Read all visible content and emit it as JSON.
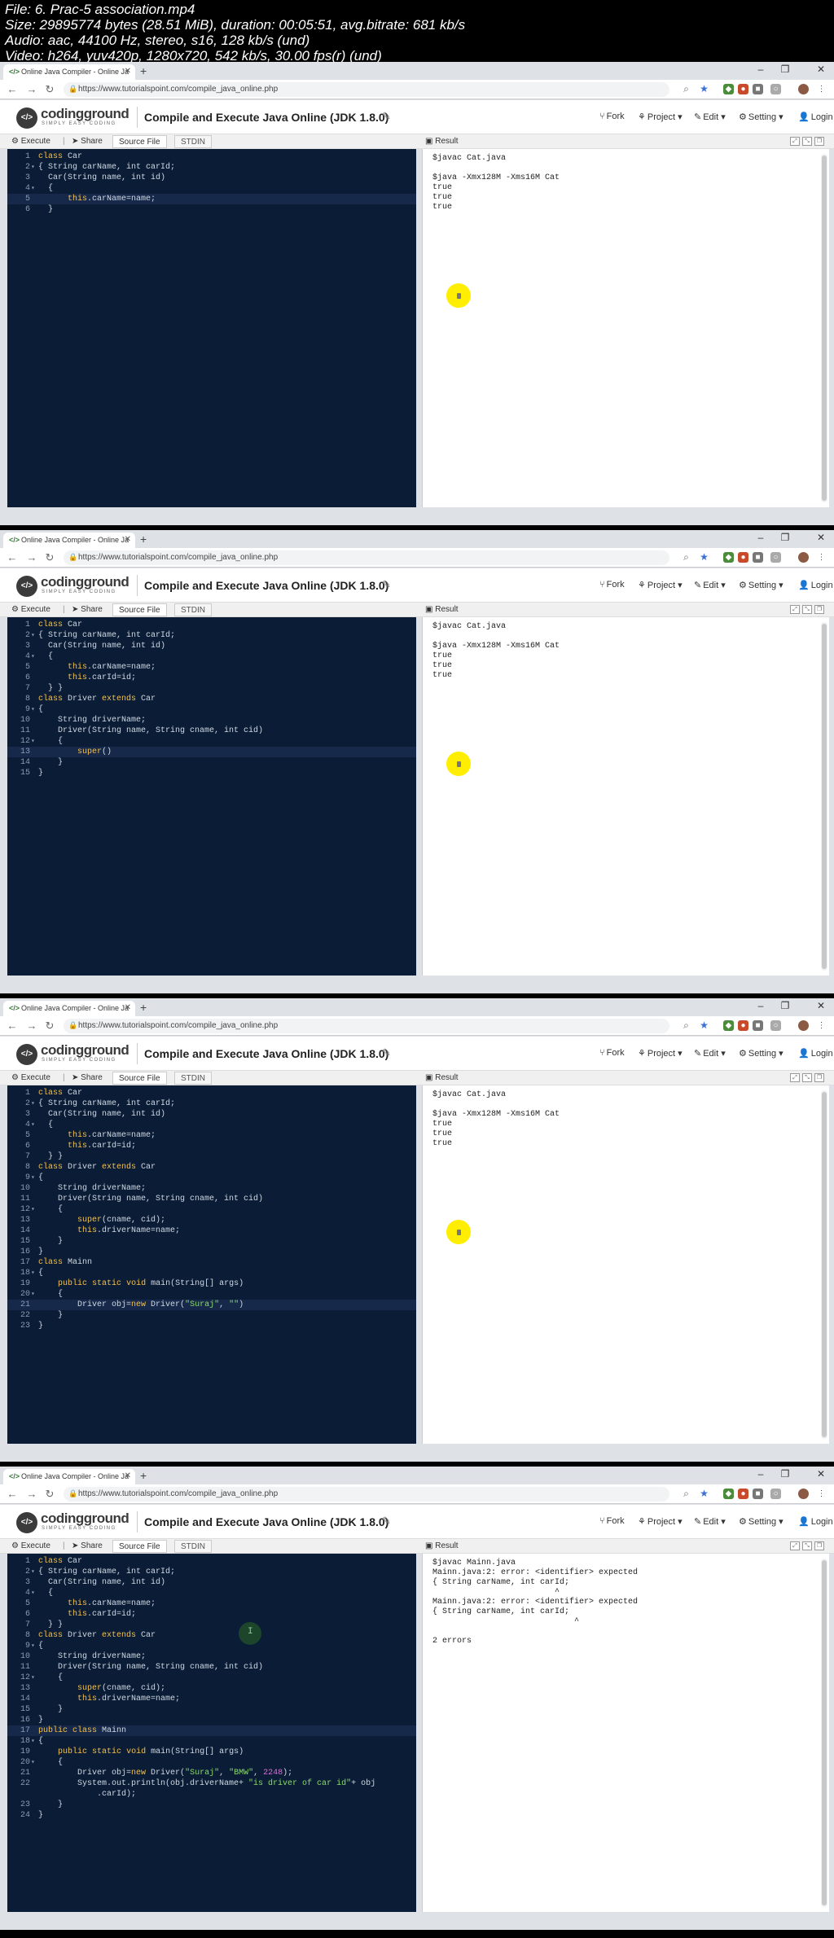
{
  "file_info": {
    "line1": "File: 6. Prac-5 association.mp4",
    "line2": "Size: 29895774 bytes (28.51 MiB), duration: 00:05:51, avg.bitrate: 681 kb/s",
    "line3": "Audio: aac, 44100 Hz, stereo, s16, 128 kb/s (und)",
    "line4": "Video: h264, yuv420p, 1280x720, 542 kb/s, 30.00 fps(r) (und)"
  },
  "browser": {
    "tab_title": "Online Java Compiler - Online Ja",
    "url": "https://www.tutorialspoint.com/compile_java_online.php"
  },
  "site": {
    "logo_text": "codingground",
    "logo_sub": "SIMPLY EASY CODING",
    "page_title": "Compile and Execute Java Online (JDK 1.8.0)",
    "menu": {
      "fork": "Fork",
      "project": "Project",
      "edit": "Edit",
      "setting": "Setting",
      "login": "Login"
    }
  },
  "toolbar": {
    "execute": "Execute",
    "share": "Share",
    "source_file": "Source File",
    "stdin": "STDIN",
    "result": "Result"
  },
  "frames": [
    {
      "code": [
        "class Car",
        "{ String carName, int carId;",
        "  Car(String name, int id)",
        "  {",
        "      this.carName=name;",
        "  }"
      ],
      "active_line": 5,
      "output": [
        "$javac Cat.java",
        "",
        "$java -Xmx128M -Xms16M Cat",
        "true",
        "true",
        "true"
      ]
    },
    {
      "code": [
        "class Car",
        "{ String carName, int carId;",
        "  Car(String name, int id)",
        "  {",
        "      this.carName=name;",
        "      this.carId=id;",
        "  } }",
        "class Driver extends Car",
        "{",
        "    String driverName;",
        "    Driver(String name, String cname, int cid)",
        "    {",
        "        super()",
        "    }",
        "}"
      ],
      "active_line": 13,
      "output": [
        "$javac Cat.java",
        "",
        "$java -Xmx128M -Xms16M Cat",
        "true",
        "true",
        "true"
      ]
    },
    {
      "code": [
        "class Car",
        "{ String carName, int carId;",
        "  Car(String name, int id)",
        "  {",
        "      this.carName=name;",
        "      this.carId=id;",
        "  } }",
        "class Driver extends Car",
        "{",
        "    String driverName;",
        "    Driver(String name, String cname, int cid)",
        "    {",
        "        super(cname, cid);",
        "        this.driverName=name;",
        "    }",
        "}",
        "class Mainn",
        "{",
        "    public static void main(String[] args)",
        "    {",
        "        Driver obj=new Driver(\"Suraj\", \"\")",
        "    }",
        "}"
      ],
      "active_line": 21,
      "output": [
        "$javac Cat.java",
        "",
        "$java -Xmx128M -Xms16M Cat",
        "true",
        "true",
        "true"
      ]
    },
    {
      "code": [
        "class Car",
        "{ String carName, int carId;",
        "  Car(String name, int id)",
        "  {",
        "      this.carName=name;",
        "      this.carId=id;",
        "  } }",
        "class Driver extends Car",
        "{",
        "    String driverName;",
        "    Driver(String name, String cname, int cid)",
        "    {",
        "        super(cname, cid);",
        "        this.driverName=name;",
        "    }",
        "}",
        "public class Mainn",
        "{",
        "    public static void main(String[] args)",
        "    {",
        "        Driver obj=new Driver(\"Suraj\", \"BMW\", 2248);",
        "        System.out.println(obj.driverName+ \"is driver of car id\"+ obj",
        "            .carId);",
        "    }",
        "}"
      ],
      "line_numbers": [
        "1",
        "2",
        "3",
        "4",
        "5",
        "6",
        "7",
        "8",
        "9",
        "10",
        "11",
        "12",
        "13",
        "14",
        "15",
        "16",
        "17",
        "18",
        "19",
        "20",
        "21",
        "22",
        "",
        "23",
        "24"
      ],
      "active_line": 17,
      "output": [
        "$javac Mainn.java",
        "Mainn.java:2: error: <identifier> expected",
        "{ String carName, int carId;",
        "                         ^",
        "Mainn.java:2: error: <identifier> expected",
        "{ String carName, int carId;",
        "                             ^",
        "",
        "2 errors"
      ]
    }
  ],
  "colors": {
    "editor_bg": "#0b1d36",
    "keyword": "#f5c04a",
    "string": "#8bd86b",
    "number": "#e06cd8",
    "cursor_highlight": "#ffee00"
  }
}
